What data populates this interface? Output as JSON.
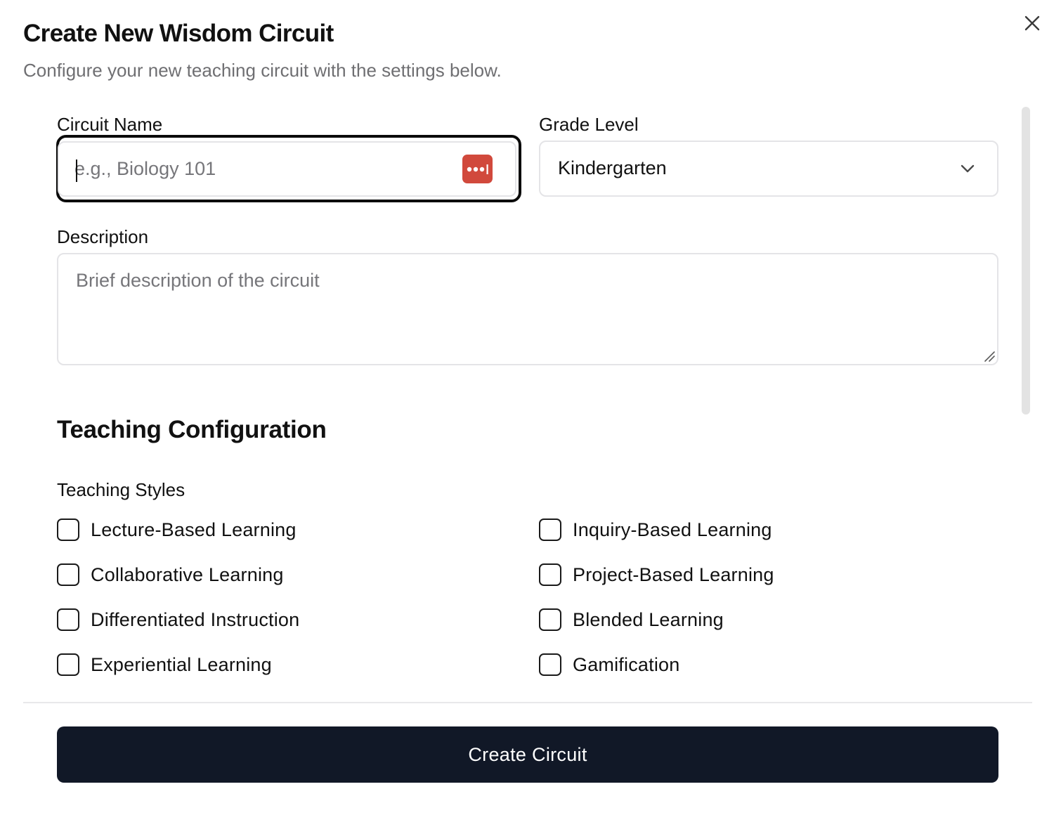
{
  "dialog": {
    "title": "Create New Wisdom Circuit",
    "subtitle": "Configure your new teaching circuit with the settings below.",
    "close_icon": "close-icon"
  },
  "form": {
    "circuit_name": {
      "label": "Circuit Name",
      "value": "",
      "placeholder": "e.g., Biology 101",
      "password_manager_icon": "password-manager-icon",
      "icon_color": "#d1493c"
    },
    "grade_level": {
      "label": "Grade Level",
      "value": "Kindergarten",
      "icon": "chevron-down-icon"
    },
    "description": {
      "label": "Description",
      "value": "",
      "placeholder": "Brief description of the circuit"
    }
  },
  "teaching_configuration": {
    "title": "Teaching Configuration",
    "styles_label": "Teaching Styles",
    "styles": [
      {
        "label": "Lecture-Based Learning",
        "checked": false
      },
      {
        "label": "Inquiry-Based Learning",
        "checked": false
      },
      {
        "label": "Collaborative Learning",
        "checked": false
      },
      {
        "label": "Project-Based Learning",
        "checked": false
      },
      {
        "label": "Differentiated Instruction",
        "checked": false
      },
      {
        "label": "Blended Learning",
        "checked": false
      },
      {
        "label": "Experiential Learning",
        "checked": false
      },
      {
        "label": "Gamification",
        "checked": false
      }
    ]
  },
  "footer": {
    "create_label": "Create Circuit",
    "button_color": "#111827"
  }
}
